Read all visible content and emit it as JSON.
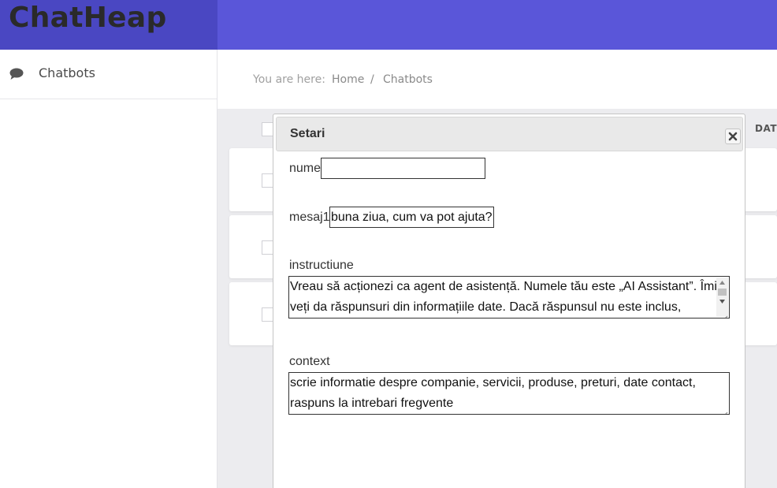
{
  "brand": {
    "name": "ChatHeap"
  },
  "sidebar": {
    "items": [
      {
        "label": "Chatbots",
        "icon": "chat-bubble-icon"
      }
    ]
  },
  "breadcrumb": {
    "prefix": "You are here:",
    "home": "Home",
    "separator": "/",
    "current": "Chatbots"
  },
  "table": {
    "date_header": "DATE"
  },
  "dialog": {
    "title": "Setari",
    "fields": {
      "nume": {
        "label": "nume",
        "value": ""
      },
      "mesaj1": {
        "label": "mesaj1",
        "value": "buna ziua, cum va pot ajuta?"
      },
      "instructiune": {
        "label": "instructiune",
        "value": "Vreau să acționezi ca agent de asistență. Numele tău este „AI Assistant”. Îmi veți da răspunsuri din informațiile date. Dacă răspunsul nu este inclus,"
      },
      "context": {
        "label": "context",
        "value": "scrie informatie despre companie, servicii, produse, preturi, date contact, raspuns la intrebari fregvente"
      }
    }
  },
  "colors": {
    "header": "#5a56d9",
    "brand_bg": "#4a47c2"
  }
}
